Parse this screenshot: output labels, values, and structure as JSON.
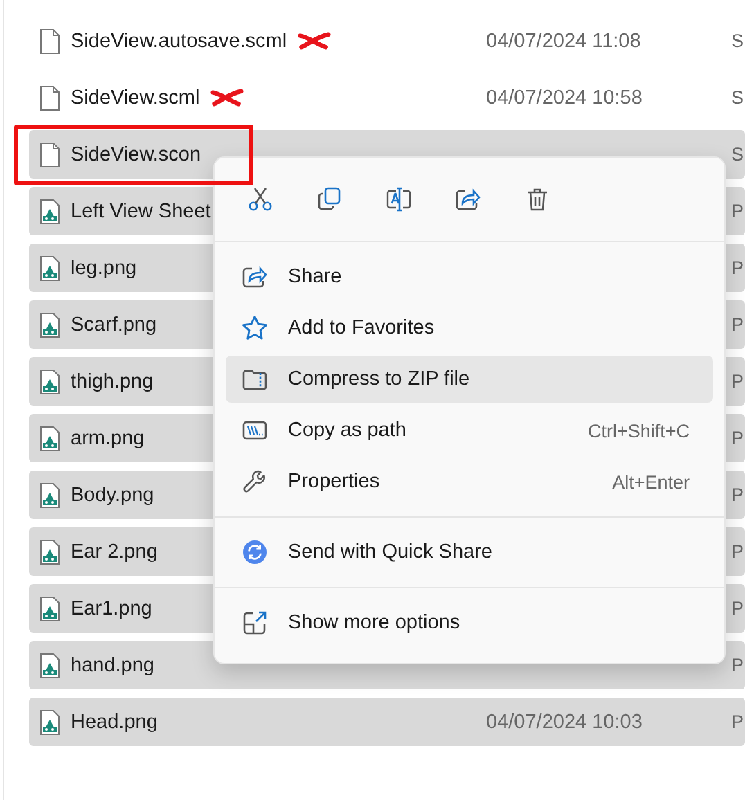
{
  "file_list": {
    "rows": [
      {
        "name": "SideView.autosave.scml",
        "kind": "file",
        "modified": "04/07/2024 11:08",
        "type": "S",
        "selected": false,
        "crossed_out": true,
        "boxed": false
      },
      {
        "name": "SideView.scml",
        "kind": "file",
        "modified": "04/07/2024 10:58",
        "type": "S",
        "selected": false,
        "crossed_out": true,
        "boxed": false
      },
      {
        "name": "SideView.scon",
        "kind": "file",
        "type": "S",
        "selected": true,
        "crossed_out": false,
        "boxed": true
      },
      {
        "name": "Left View Sheet",
        "kind": "image",
        "type": "P",
        "selected": true,
        "crossed_out": false,
        "boxed": false
      },
      {
        "name": "leg.png",
        "kind": "image",
        "type": "P",
        "selected": true,
        "crossed_out": false,
        "boxed": false
      },
      {
        "name": "Scarf.png",
        "kind": "image",
        "type": "P",
        "selected": true,
        "crossed_out": false,
        "boxed": false
      },
      {
        "name": "thigh.png",
        "kind": "image",
        "type": "P",
        "selected": true,
        "crossed_out": false,
        "boxed": false
      },
      {
        "name": "arm.png",
        "kind": "image",
        "type": "P",
        "selected": true,
        "crossed_out": false,
        "boxed": false
      },
      {
        "name": "Body.png",
        "kind": "image",
        "type": "P",
        "selected": true,
        "crossed_out": false,
        "boxed": false
      },
      {
        "name": "Ear 2.png",
        "kind": "image",
        "type": "P",
        "selected": true,
        "crossed_out": false,
        "boxed": false
      },
      {
        "name": "Ear1.png",
        "kind": "image",
        "type": "P",
        "selected": true,
        "crossed_out": false,
        "boxed": false
      },
      {
        "name": "hand.png",
        "kind": "image",
        "type": "P",
        "selected": true,
        "crossed_out": false,
        "boxed": false
      },
      {
        "name": "Head.png",
        "kind": "image",
        "modified": "04/07/2024 10:03",
        "type": "P",
        "selected": true,
        "crossed_out": false,
        "boxed": false
      }
    ]
  },
  "context_menu": {
    "toolbar": [
      {
        "kind": "cut"
      },
      {
        "kind": "copy"
      },
      {
        "kind": "rename"
      },
      {
        "kind": "share"
      },
      {
        "kind": "delete"
      }
    ],
    "groups": [
      [
        {
          "kind": "share",
          "label": "Share",
          "hovered": false
        },
        {
          "kind": "favorite",
          "label": "Add to Favorites",
          "hovered": false
        },
        {
          "kind": "zip",
          "label": "Compress to ZIP file",
          "hovered": true
        },
        {
          "kind": "path",
          "label": "Copy as path",
          "shortcut": "Ctrl+Shift+C",
          "hovered": false
        },
        {
          "kind": "properties",
          "label": "Properties",
          "shortcut": "Alt+Enter",
          "hovered": false
        }
      ],
      [
        {
          "kind": "quickshare",
          "label": "Send with Quick Share",
          "hovered": false
        }
      ],
      [
        {
          "kind": "more",
          "label": "Show more options",
          "hovered": false
        }
      ]
    ]
  }
}
